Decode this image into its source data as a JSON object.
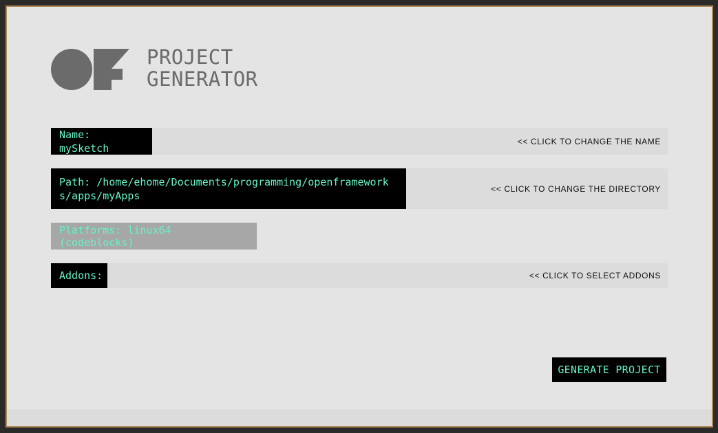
{
  "app": {
    "title_line1": "PROJECT",
    "title_line2": "GENERATOR",
    "logo_icon": "openframeworks-logo-icon"
  },
  "name_row": {
    "label": "Name: mySketch",
    "hint": "<< CLICK TO CHANGE THE NAME"
  },
  "path_row": {
    "label": "Path: /home/ehome/Documents/programming/openframeworks/apps/myApps",
    "hint": "<< CLICK TO CHANGE THE DIRECTORY"
  },
  "platforms_row": {
    "label": "Platforms: linux64 (codeblocks)"
  },
  "addons_row": {
    "label": "Addons:",
    "hint": "<< CLICK TO SELECT ADDONS"
  },
  "generate_button": {
    "label": "GENERATE PROJECT"
  },
  "colors": {
    "background": "#e4e4e4",
    "label_bg": "#000000",
    "accent_text": "#66f2c8",
    "platforms_bg": "#a7a7a7",
    "logo_gray": "#6b6b6b",
    "frame_border": "#b08a55"
  }
}
